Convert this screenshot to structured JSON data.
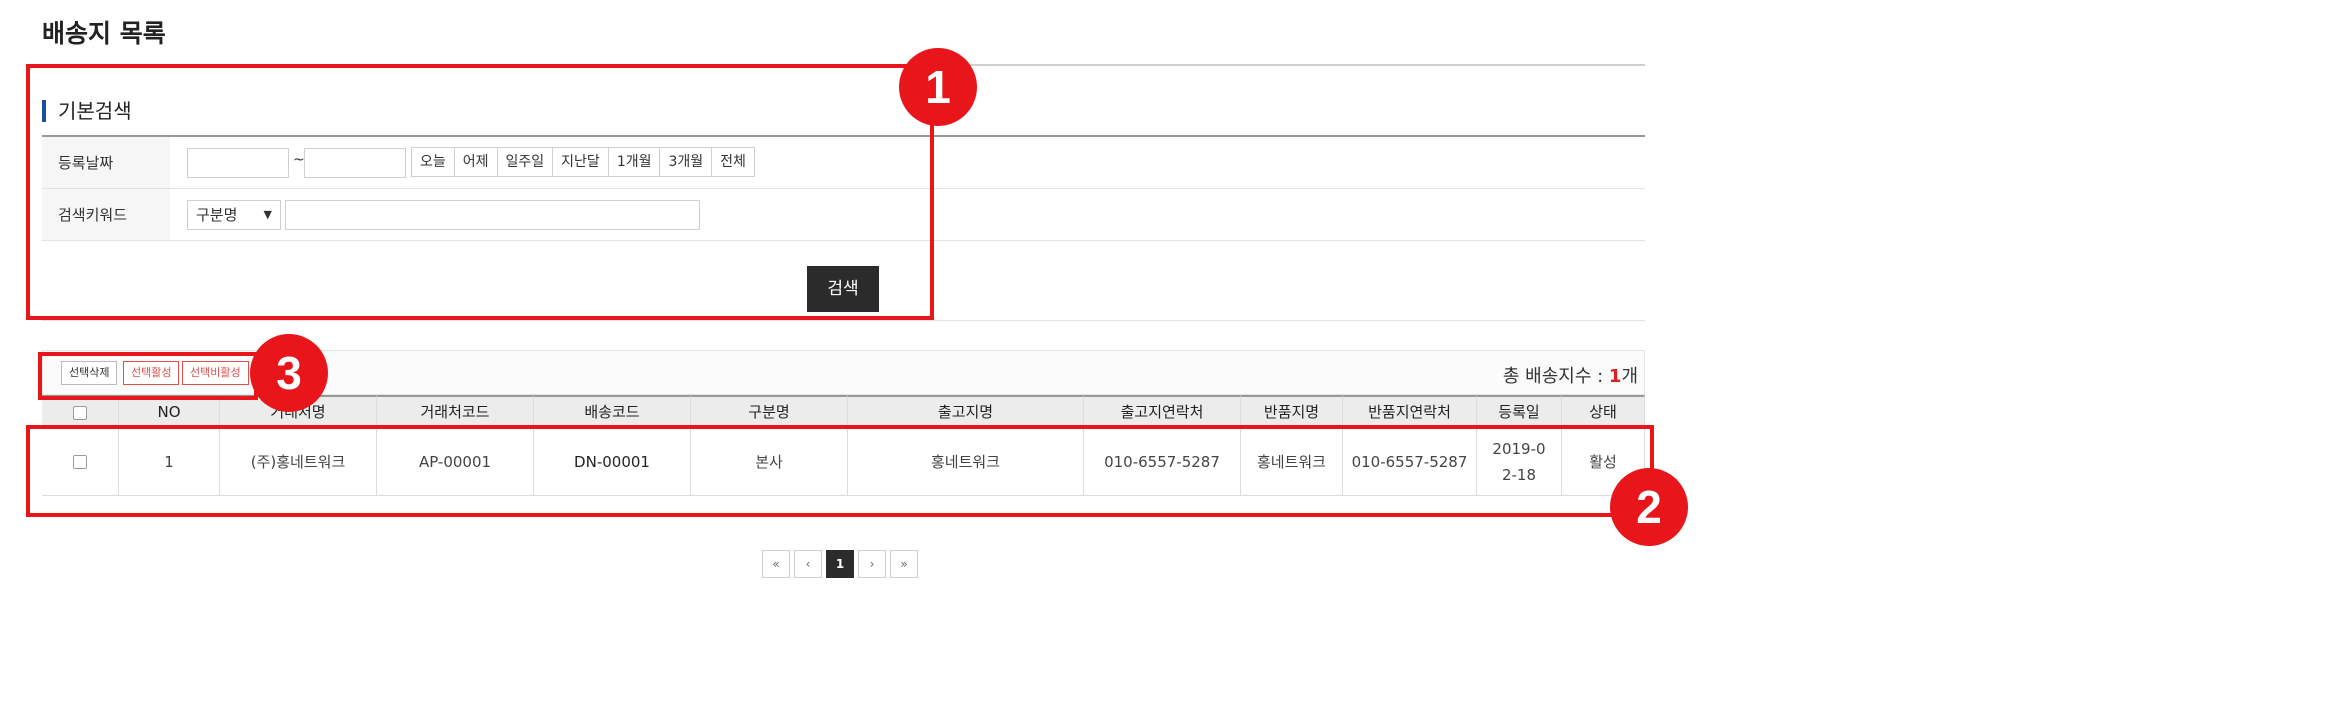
{
  "page": {
    "title": "배송지 목록"
  },
  "search": {
    "section_title": "기본검색",
    "date_label": "등록날짜",
    "date_from": "",
    "date_to": "",
    "tilde": "~",
    "date_buttons": [
      "오늘",
      "어제",
      "일주일",
      "지난달",
      "1개월",
      "3개월",
      "전체"
    ],
    "keyword_label": "검색키워드",
    "keyword_select": "구분명",
    "keyword_select_arrow": "▼",
    "keyword_value": "",
    "submit_label": "검색"
  },
  "toolbar": {
    "delete_label": "선택삭제",
    "activate_label": "선택활성",
    "deactivate_label": "선택비활성",
    "total_prefix": "총 배송지수 : ",
    "total_count": "1",
    "total_suffix": "개"
  },
  "table": {
    "headers": [
      "NO",
      "거래처명",
      "거래처코드",
      "배송코드",
      "구분명",
      "출고지명",
      "출고지연락처",
      "반품지명",
      "반품지연락처",
      "등록일",
      "상태"
    ],
    "rows": [
      [
        "1",
        "(주)홍네트워크",
        "AP-00001",
        "DN-00001",
        "본사",
        "홍네트워크",
        "010-6557-5287",
        "홍네트워크",
        "010-6557-5287",
        "2019-02-18",
        "활성"
      ]
    ]
  },
  "pagination": {
    "first": "«",
    "prev": "‹",
    "current": "1",
    "next": "›",
    "last": "»"
  },
  "callouts": [
    "1",
    "2",
    "3"
  ],
  "colors": {
    "callout": "#e8161b",
    "accent_bar": "#1d4fa0",
    "total_count": "#e02020"
  }
}
